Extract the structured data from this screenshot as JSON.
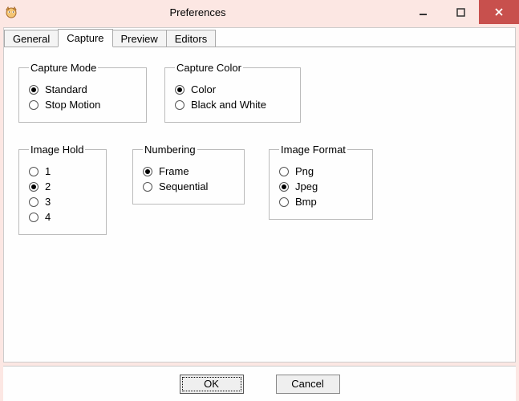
{
  "window": {
    "title": "Preferences"
  },
  "tabs": {
    "general": "General",
    "capture": "Capture",
    "preview": "Preview",
    "editors": "Editors"
  },
  "groups": {
    "captureMode": {
      "legend": "Capture Mode",
      "options": {
        "standard": "Standard",
        "stopMotion": "Stop Motion"
      }
    },
    "captureColor": {
      "legend": "Capture Color",
      "options": {
        "color": "Color",
        "bw": "Black and White"
      }
    },
    "imageHold": {
      "legend": "Image Hold",
      "options": {
        "h1": "1",
        "h2": "2",
        "h3": "3",
        "h4": "4"
      }
    },
    "numbering": {
      "legend": "Numbering",
      "options": {
        "frame": "Frame",
        "sequential": "Sequential"
      }
    },
    "imageFormat": {
      "legend": "Image Format",
      "options": {
        "png": "Png",
        "jpeg": "Jpeg",
        "bmp": "Bmp"
      }
    }
  },
  "buttons": {
    "ok": "OK",
    "cancel": "Cancel"
  }
}
